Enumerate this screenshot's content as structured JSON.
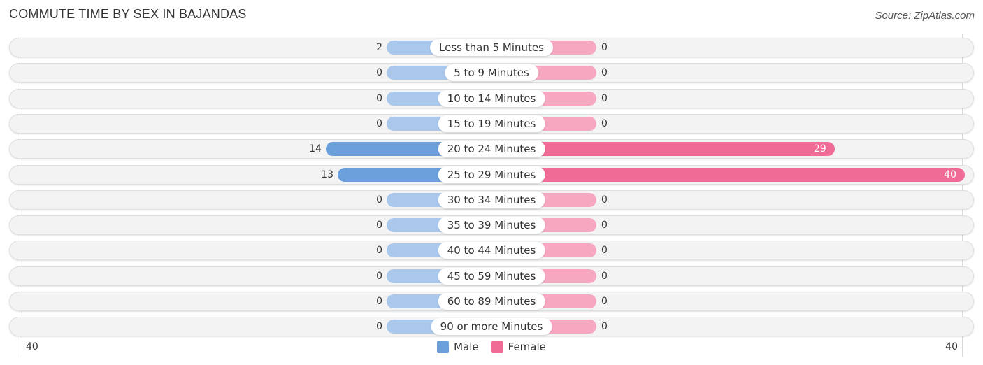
{
  "title": "COMMUTE TIME BY SEX IN BAJANDAS",
  "source": "Source: ZipAtlas.com",
  "colors": {
    "male_light": "#a9c8ec",
    "male_strong": "#6a9fdb",
    "female_light": "#f7a8c1",
    "female_strong": "#f06c96"
  },
  "axis": {
    "left_tick": "40",
    "right_tick": "40"
  },
  "legend": {
    "male": "Male",
    "female": "Female"
  },
  "chart_data": {
    "type": "bar",
    "orientation": "horizontal-diverging",
    "title": "COMMUTE TIME BY SEX IN BAJANDAS",
    "categories": [
      "Less than 5 Minutes",
      "5 to 9 Minutes",
      "10 to 14 Minutes",
      "15 to 19 Minutes",
      "20 to 24 Minutes",
      "25 to 29 Minutes",
      "30 to 34 Minutes",
      "35 to 39 Minutes",
      "40 to 44 Minutes",
      "45 to 59 Minutes",
      "60 to 89 Minutes",
      "90 or more Minutes"
    ],
    "series": [
      {
        "name": "Male",
        "values": [
          2,
          0,
          0,
          0,
          14,
          13,
          0,
          0,
          0,
          0,
          0,
          0
        ]
      },
      {
        "name": "Female",
        "values": [
          0,
          0,
          0,
          0,
          29,
          40,
          0,
          0,
          0,
          0,
          0,
          0
        ]
      }
    ],
    "xlim": [
      -40,
      40
    ],
    "xlabel": "",
    "ylabel": "",
    "legend_position": "bottom-center",
    "grid": false
  }
}
